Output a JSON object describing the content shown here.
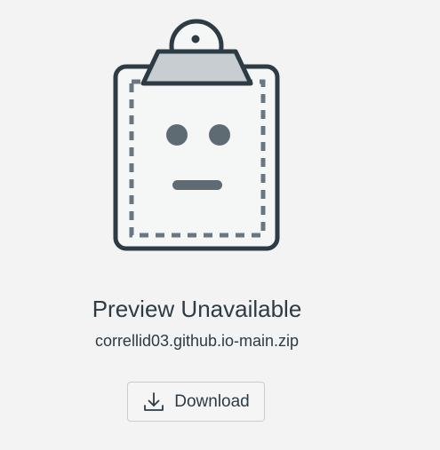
{
  "preview": {
    "title": "Preview Unavailable",
    "filename": "correllid03.github.io-main.zip"
  },
  "download": {
    "label": "Download",
    "icon": "download-icon"
  },
  "colors": {
    "background": "#f2f3f2",
    "text": "#2d3b45",
    "clipboard_outline": "#2d3b45",
    "clipboard_clip": "#c7cdd1",
    "face": "#5f6b73"
  }
}
